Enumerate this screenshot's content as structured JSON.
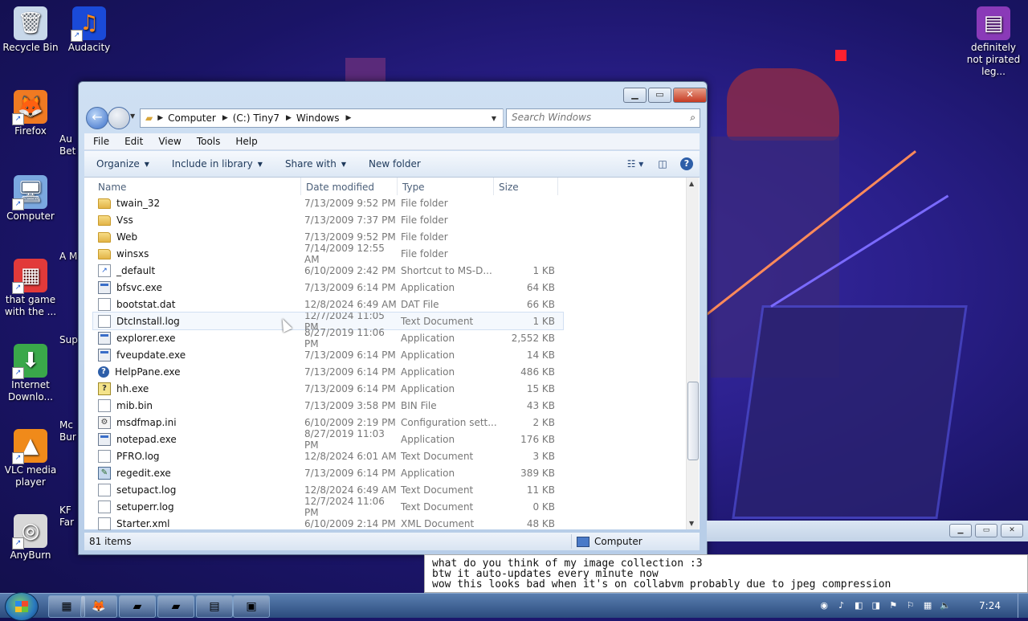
{
  "desktop": {
    "icons_left": [
      {
        "label": "Recycle Bin",
        "icon": "recycle-bin-icon",
        "glyph": "🗑",
        "color": "#c8d8ea"
      },
      {
        "label": "Firefox",
        "icon": "firefox-icon",
        "glyph": "🦊",
        "color": "#f07a22"
      },
      {
        "label": "Computer",
        "icon": "computer-icon",
        "glyph": "🖥",
        "color": "#7aa8e0"
      },
      {
        "label": "that game with the ...",
        "icon": "game-icon",
        "glyph": "▦",
        "color": "#e23a3a"
      },
      {
        "label": "Internet Downlo...",
        "icon": "download-manager-icon",
        "glyph": "⬇",
        "color": "#3aa84a"
      },
      {
        "label": "VLC media player",
        "icon": "vlc-icon",
        "glyph": "▲",
        "color": "#f08a1a"
      },
      {
        "label": "AnyBurn",
        "icon": "anyburn-icon",
        "glyph": "◎",
        "color": "#d8d8d8"
      }
    ],
    "icons_second": [
      {
        "label": "Audacity",
        "icon": "audacity-icon",
        "glyph": "♫",
        "color": "#1a4ad8"
      },
      {
        "label": "Au Bet",
        "icon": "app-icon",
        "glyph": "",
        "color": "transparent"
      },
      {
        "label": "A M",
        "icon": "app-icon",
        "glyph": "",
        "color": "transparent"
      },
      {
        "label": "Sup",
        "icon": "app-icon",
        "glyph": "",
        "color": "transparent"
      },
      {
        "label": "Mc Bur",
        "icon": "app-icon",
        "glyph": "",
        "color": "transparent"
      },
      {
        "label": "KF Far",
        "icon": "app-icon",
        "glyph": "",
        "color": "transparent"
      }
    ],
    "icon_right": {
      "label": "definitely not pirated leg...",
      "icon": "winrar-icon",
      "glyph": "▤",
      "color": "#8a3ab8"
    }
  },
  "explorer": {
    "breadcrumb": [
      "Computer",
      "(C:) Tiny7",
      "Windows"
    ],
    "search_placeholder": "Search Windows",
    "menu": [
      "File",
      "Edit",
      "View",
      "Tools",
      "Help"
    ],
    "toolbar": {
      "organize": "Organize",
      "include": "Include in library",
      "share": "Share with",
      "newfolder": "New folder"
    },
    "columns": {
      "name": "Name",
      "date": "Date modified",
      "type": "Type",
      "size": "Size"
    },
    "files": [
      {
        "name": "twain_32",
        "date": "7/13/2009 9:52 PM",
        "type": "File folder",
        "size": "",
        "icon": "folder"
      },
      {
        "name": "Vss",
        "date": "7/13/2009 7:37 PM",
        "type": "File folder",
        "size": "",
        "icon": "folder"
      },
      {
        "name": "Web",
        "date": "7/13/2009 9:52 PM",
        "type": "File folder",
        "size": "",
        "icon": "folder"
      },
      {
        "name": "winsxs",
        "date": "7/14/2009 12:55 AM",
        "type": "File folder",
        "size": "",
        "icon": "folder"
      },
      {
        "name": "_default",
        "date": "6/10/2009 2:42 PM",
        "type": "Shortcut to MS-D...",
        "size": "1 KB",
        "icon": "short"
      },
      {
        "name": "bfsvc.exe",
        "date": "7/13/2009 6:14 PM",
        "type": "Application",
        "size": "64 KB",
        "icon": "app"
      },
      {
        "name": "bootstat.dat",
        "date": "12/8/2024 6:49 AM",
        "type": "DAT File",
        "size": "66 KB",
        "icon": "doc"
      },
      {
        "name": "DtcInstall.log",
        "date": "12/7/2024 11:05 PM",
        "type": "Text Document",
        "size": "1 KB",
        "icon": "doc",
        "hover": true
      },
      {
        "name": "explorer.exe",
        "date": "8/27/2019 11:06 PM",
        "type": "Application",
        "size": "2,552 KB",
        "icon": "app"
      },
      {
        "name": "fveupdate.exe",
        "date": "7/13/2009 6:14 PM",
        "type": "Application",
        "size": "14 KB",
        "icon": "app"
      },
      {
        "name": "HelpPane.exe",
        "date": "7/13/2009 6:14 PM",
        "type": "Application",
        "size": "486 KB",
        "icon": "help"
      },
      {
        "name": "hh.exe",
        "date": "7/13/2009 6:14 PM",
        "type": "Application",
        "size": "15 KB",
        "icon": "hh"
      },
      {
        "name": "mib.bin",
        "date": "7/13/2009 3:58 PM",
        "type": "BIN File",
        "size": "43 KB",
        "icon": "doc"
      },
      {
        "name": "msdfmap.ini",
        "date": "6/10/2009 2:19 PM",
        "type": "Configuration sett...",
        "size": "2 KB",
        "icon": "cfg"
      },
      {
        "name": "notepad.exe",
        "date": "8/27/2019 11:03 PM",
        "type": "Application",
        "size": "176 KB",
        "icon": "app"
      },
      {
        "name": "PFRO.log",
        "date": "12/8/2024 6:01 AM",
        "type": "Text Document",
        "size": "3 KB",
        "icon": "doc"
      },
      {
        "name": "regedit.exe",
        "date": "7/13/2009 6:14 PM",
        "type": "Application",
        "size": "389 KB",
        "icon": "reg"
      },
      {
        "name": "setupact.log",
        "date": "12/8/2024 6:49 AM",
        "type": "Text Document",
        "size": "11 KB",
        "icon": "doc"
      },
      {
        "name": "setuperr.log",
        "date": "12/7/2024 11:06 PM",
        "type": "Text Document",
        "size": "0 KB",
        "icon": "doc"
      },
      {
        "name": "Starter.xml",
        "date": "6/10/2009 2:14 PM",
        "type": "XML Document",
        "size": "48 KB",
        "icon": "doc"
      }
    ],
    "status_count": "81 items",
    "status_location": "Computer"
  },
  "chat": [
    "what do you think of my image collection :3",
    "btw it auto-updates every minute now",
    "wow this looks bad when it's on collabvm probably due to jpeg compression"
  ],
  "taskbar": {
    "clock": "7:24"
  }
}
